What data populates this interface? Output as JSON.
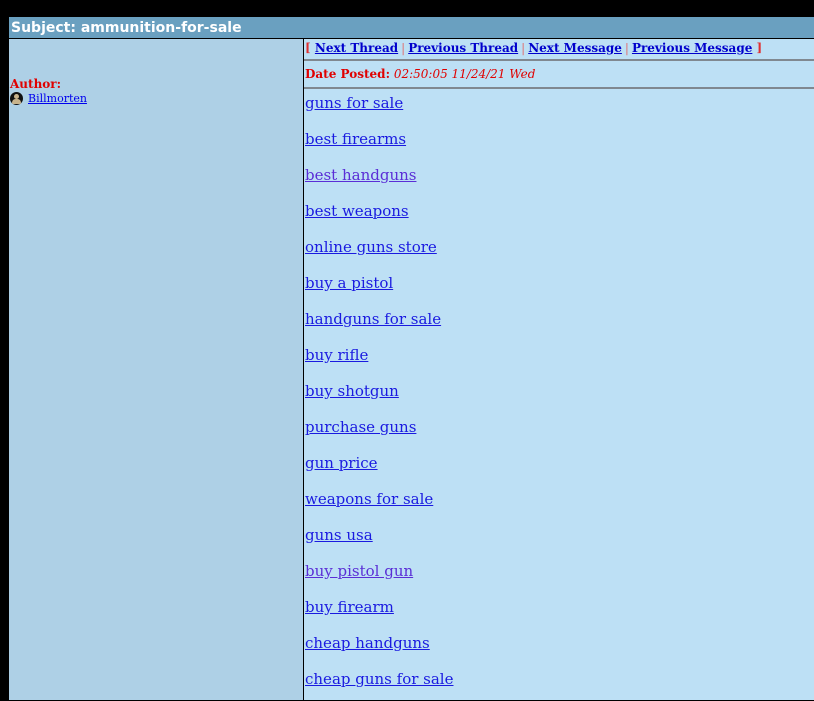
{
  "subject": {
    "label": "Subject:",
    "title": "ammunition-for-sale",
    "full": "Subject: ammunition-for-sale"
  },
  "author": {
    "label": "Author:",
    "name": "Billmorten",
    "icon": "user-avatar-icon"
  },
  "nav": {
    "open_bracket": "[",
    "close_bracket": "]",
    "separator": "|",
    "next_thread": "Next Thread",
    "previous_thread": "Previous Thread",
    "next_message": "Next Message",
    "previous_message": "Previous Message"
  },
  "post": {
    "date_label": "Date Posted:",
    "date_value": "02:50:05 11/24/21 Wed"
  },
  "links": [
    {
      "text": "guns for sale",
      "visited": false
    },
    {
      "text": "best firearms",
      "visited": false
    },
    {
      "text": "best handguns",
      "visited": true
    },
    {
      "text": "best weapons",
      "visited": false
    },
    {
      "text": "online guns store",
      "visited": false
    },
    {
      "text": "buy a pistol",
      "visited": false
    },
    {
      "text": "handguns for sale",
      "visited": false
    },
    {
      "text": "buy rifle",
      "visited": false
    },
    {
      "text": "buy shotgun",
      "visited": false
    },
    {
      "text": "purchase guns",
      "visited": false
    },
    {
      "text": "gun price",
      "visited": false
    },
    {
      "text": "weapons for sale",
      "visited": false
    },
    {
      "text": "guns usa",
      "visited": false
    },
    {
      "text": "buy pistol gun",
      "visited": true
    },
    {
      "text": "buy firearm",
      "visited": false
    },
    {
      "text": "cheap handguns",
      "visited": false
    },
    {
      "text": "cheap guns for sale",
      "visited": false
    }
  ],
  "colors": {
    "subject_bar": "#6aa0c0",
    "left_panel": "#aed0e6",
    "right_panel": "#bde0f5",
    "label_red": "#e00000",
    "link_blue": "#1a1ae0",
    "link_visited": "#5a2ed6"
  }
}
